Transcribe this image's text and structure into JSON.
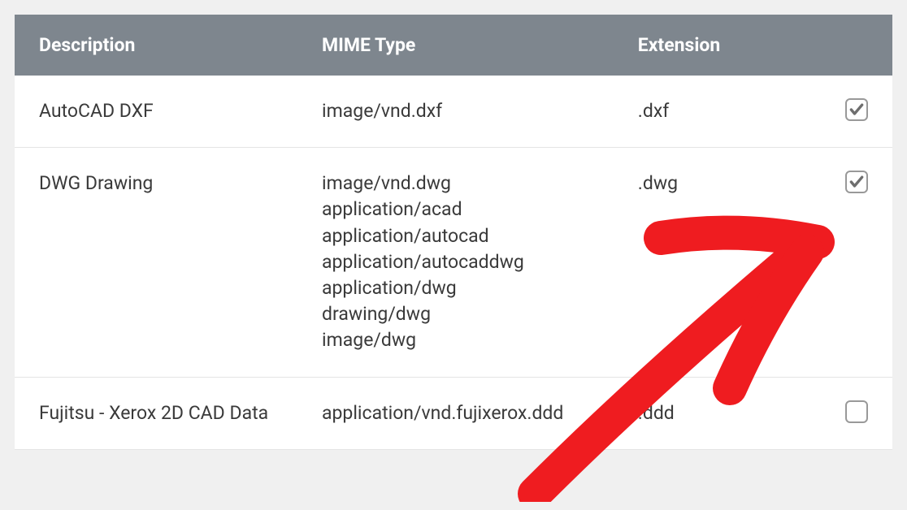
{
  "table": {
    "headers": {
      "description": "Description",
      "mime": "MIME Type",
      "extension": "Extension"
    },
    "rows": [
      {
        "description": "AutoCAD DXF",
        "mimes": [
          "image/vnd.dxf"
        ],
        "extension": ".dxf",
        "checked": true
      },
      {
        "description": "DWG Drawing",
        "mimes": [
          "image/vnd.dwg",
          "application/acad",
          "application/autocad",
          "application/autocaddwg",
          "application/dwg",
          "drawing/dwg",
          "image/dwg"
        ],
        "extension": ".dwg",
        "checked": true
      },
      {
        "description": "Fujitsu - Xerox 2D CAD Data",
        "mimes": [
          "application/vnd.fujixerox.ddd"
        ],
        "extension": ".ddd",
        "checked": false
      }
    ]
  },
  "annotation": {
    "color": "#ef1c20",
    "type": "hand-drawn-arrow"
  }
}
